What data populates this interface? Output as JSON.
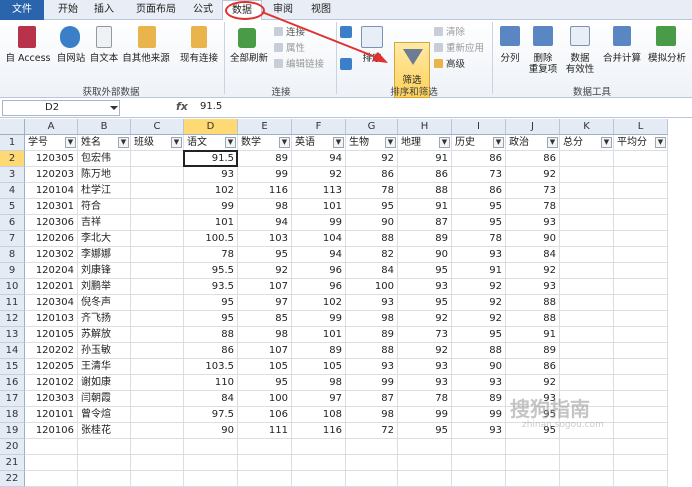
{
  "tabs": [
    {
      "label": "文件",
      "kind": "file"
    },
    {
      "label": "开始"
    },
    {
      "label": "插入"
    },
    {
      "label": "页面布局"
    },
    {
      "label": "公式"
    },
    {
      "label": "数据",
      "kind": "active"
    },
    {
      "label": "审阅"
    },
    {
      "label": "视图"
    }
  ],
  "ribbon": {
    "get_external": {
      "access": "自 Access",
      "web": "自网站",
      "text": "自文本",
      "other": "自其他来源",
      "existing": "现有连接",
      "group": "获取外部数据"
    },
    "connections": {
      "refresh_all": "全部刷新",
      "connections": "连接",
      "properties": "属性",
      "edit_links": "编辑链接",
      "group": "连接"
    },
    "sort_filter": {
      "sort": "排序",
      "filter": "筛选",
      "clear": "清除",
      "reapply": "重新应用",
      "advanced": "高级",
      "group": "排序和筛选"
    },
    "data_tools": {
      "text_to_columns": "分列",
      "remove_duplicates": "删除\n重复项",
      "validation": "数据\n有效性",
      "consolidate": "合并计算",
      "what_if": "模拟分析",
      "group": "数据工具"
    }
  },
  "formula_bar": {
    "name_box": "D2",
    "fx": "fx",
    "value": "91.5"
  },
  "columns": [
    "A",
    "B",
    "C",
    "D",
    "E",
    "F",
    "G",
    "H",
    "I",
    "J",
    "K",
    "L"
  ],
  "headers": [
    "学号",
    "姓名",
    "班级",
    "语文",
    "数学",
    "英语",
    "生物",
    "地理",
    "历史",
    "政治",
    "总分",
    "平均分"
  ],
  "rows": [
    [
      "120305",
      "包宏伟",
      "",
      "91.5",
      "89",
      "94",
      "92",
      "91",
      "86",
      "86",
      "",
      ""
    ],
    [
      "120203",
      "陈万地",
      "",
      "93",
      "99",
      "92",
      "86",
      "86",
      "73",
      "92",
      "",
      ""
    ],
    [
      "120104",
      "杜学江",
      "",
      "102",
      "116",
      "113",
      "78",
      "88",
      "86",
      "73",
      "",
      ""
    ],
    [
      "120301",
      "符合",
      "",
      "99",
      "98",
      "101",
      "95",
      "91",
      "95",
      "78",
      "",
      ""
    ],
    [
      "120306",
      "吉祥",
      "",
      "101",
      "94",
      "99",
      "90",
      "87",
      "95",
      "93",
      "",
      ""
    ],
    [
      "120206",
      "李北大",
      "",
      "100.5",
      "103",
      "104",
      "88",
      "89",
      "78",
      "90",
      "",
      ""
    ],
    [
      "120302",
      "李娜娜",
      "",
      "78",
      "95",
      "94",
      "82",
      "90",
      "93",
      "84",
      "",
      ""
    ],
    [
      "120204",
      "刘康锋",
      "",
      "95.5",
      "92",
      "96",
      "84",
      "95",
      "91",
      "92",
      "",
      ""
    ],
    [
      "120201",
      "刘鹏举",
      "",
      "93.5",
      "107",
      "96",
      "100",
      "93",
      "92",
      "93",
      "",
      ""
    ],
    [
      "120304",
      "倪冬声",
      "",
      "95",
      "97",
      "102",
      "93",
      "95",
      "92",
      "88",
      "",
      ""
    ],
    [
      "120103",
      "齐飞扬",
      "",
      "95",
      "85",
      "99",
      "98",
      "92",
      "92",
      "88",
      "",
      ""
    ],
    [
      "120105",
      "苏解放",
      "",
      "88",
      "98",
      "101",
      "89",
      "73",
      "95",
      "91",
      "",
      ""
    ],
    [
      "120202",
      "孙玉敏",
      "",
      "86",
      "107",
      "89",
      "88",
      "92",
      "88",
      "89",
      "",
      ""
    ],
    [
      "120205",
      "王清华",
      "",
      "103.5",
      "105",
      "105",
      "93",
      "93",
      "90",
      "86",
      "",
      ""
    ],
    [
      "120102",
      "谢如康",
      "",
      "110",
      "95",
      "98",
      "99",
      "93",
      "93",
      "92",
      "",
      ""
    ],
    [
      "120303",
      "闫朝霞",
      "",
      "84",
      "100",
      "97",
      "87",
      "78",
      "89",
      "93",
      "",
      ""
    ],
    [
      "120101",
      "曾令煊",
      "",
      "97.5",
      "106",
      "108",
      "98",
      "99",
      "99",
      "95",
      "",
      ""
    ],
    [
      "120106",
      "张桂花",
      "",
      "90",
      "111",
      "116",
      "72",
      "95",
      "93",
      "95",
      "",
      ""
    ]
  ],
  "row_numbers": [
    "1",
    "2",
    "3",
    "4",
    "5",
    "6",
    "7",
    "8",
    "9",
    "10",
    "11",
    "12",
    "13",
    "14",
    "15",
    "16",
    "17",
    "18",
    "19",
    "20",
    "21",
    "22"
  ],
  "watermark": {
    "main": "搜狗指南",
    "sub": "zhinan.sogou.com"
  }
}
